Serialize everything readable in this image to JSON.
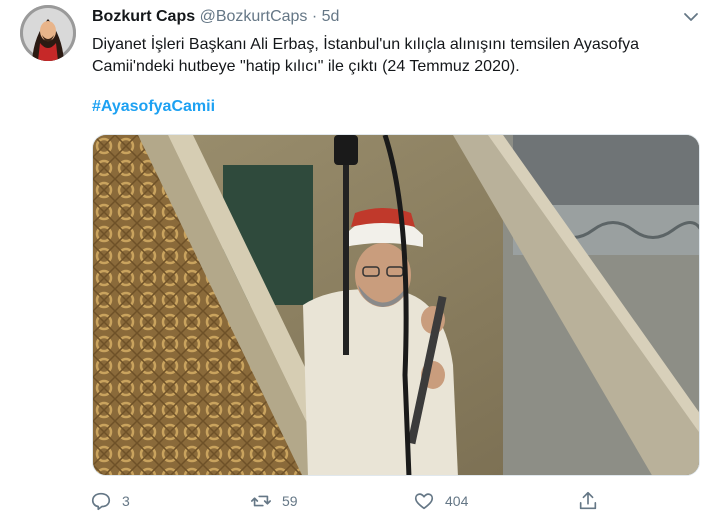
{
  "tweet": {
    "author_name": "Bozkurt Caps",
    "author_handle": "@BozkurtCaps",
    "separator": "·",
    "time": "5d",
    "text_line1": "Diyanet İşleri Başkanı Ali Erbaş, İstanbul'un kılıçla alınışını temsilen Ayasofya",
    "text_line2": "Camii'ndeki hutbeye \"hatip kılıcı\" ile çıktı (24 Temmuz 2020).",
    "hashtag": "#AyasofyaCamii"
  },
  "actions": {
    "reply_count": "3",
    "retweet_count": "59",
    "like_count": "404"
  },
  "icons": [
    "chevron-down-icon",
    "reply-icon",
    "retweet-icon",
    "like-icon",
    "share-icon"
  ],
  "colors": {
    "hashtag": "#1da1f2",
    "muted": "#657786"
  }
}
